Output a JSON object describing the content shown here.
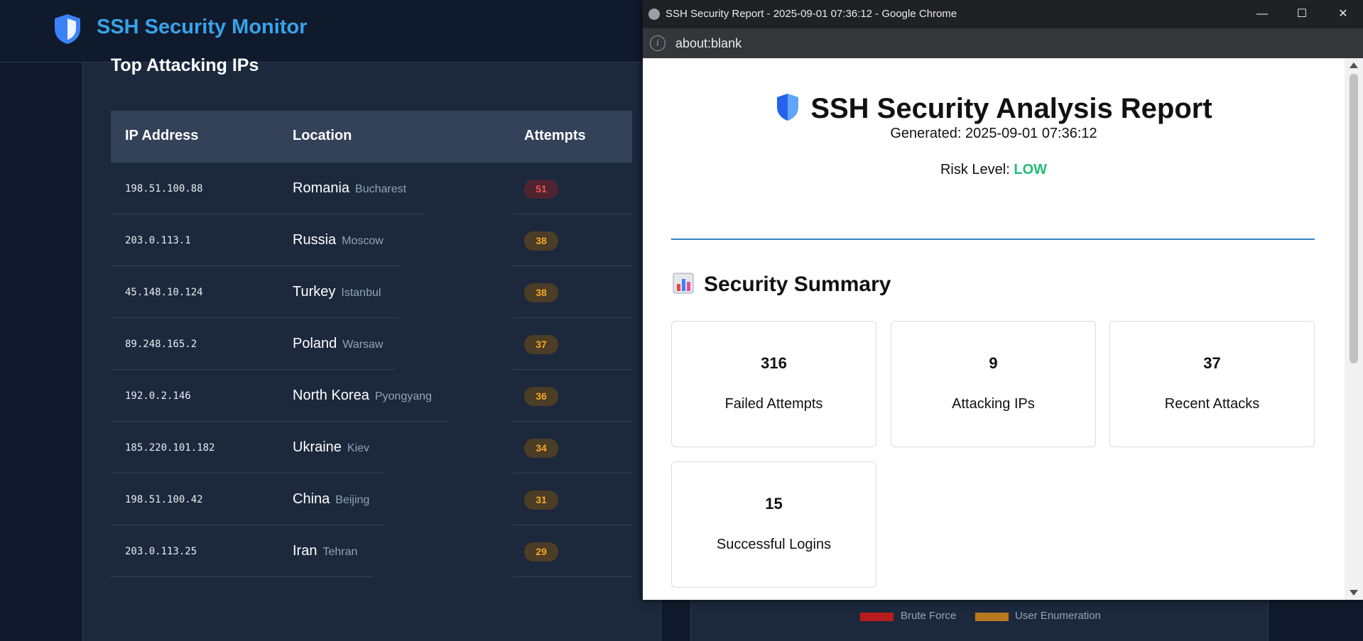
{
  "app": {
    "title": "SSH Security Monitor",
    "section_title": "Top Attacking IPs",
    "table": {
      "headers": [
        "IP Address",
        "Location",
        "Attempts"
      ],
      "rows": [
        {
          "ip": "198.51.100.88",
          "country": "Romania",
          "city": "Bucharest",
          "attempts": "51",
          "severity": "red"
        },
        {
          "ip": "203.0.113.1",
          "country": "Russia",
          "city": "Moscow",
          "attempts": "38",
          "severity": "orange"
        },
        {
          "ip": "45.148.10.124",
          "country": "Turkey",
          "city": "Istanbul",
          "attempts": "38",
          "severity": "orange"
        },
        {
          "ip": "89.248.165.2",
          "country": "Poland",
          "city": "Warsaw",
          "attempts": "37",
          "severity": "orange"
        },
        {
          "ip": "192.0.2.146",
          "country": "North Korea",
          "city": "Pyongyang",
          "attempts": "36",
          "severity": "orange"
        },
        {
          "ip": "185.220.101.182",
          "country": "Ukraine",
          "city": "Kiev",
          "attempts": "34",
          "severity": "orange"
        },
        {
          "ip": "198.51.100.42",
          "country": "China",
          "city": "Beijing",
          "attempts": "31",
          "severity": "orange"
        },
        {
          "ip": "203.0.113.25",
          "country": "Iran",
          "city": "Tehran",
          "attempts": "29",
          "severity": "orange"
        }
      ]
    },
    "legend": [
      {
        "label": "Brute Force",
        "color": "#b91c1c"
      },
      {
        "label": "User Enumeration",
        "color": "#b7791f"
      }
    ]
  },
  "browser": {
    "window_title": "SSH Security Report - 2025-09-01 07:36:12 - Google Chrome",
    "url": "about:blank",
    "controls": {
      "minimize": "—",
      "maximize": "☐",
      "close": "✕"
    }
  },
  "report": {
    "title": "SSH Security Analysis Report",
    "generated_label": "Generated: 2025-09-01 07:36:12",
    "risk_label": "Risk Level: ",
    "risk_value": "LOW",
    "summary_title": "Security Summary",
    "cards": [
      {
        "value": "316",
        "label": "Failed Attempts"
      },
      {
        "value": "9",
        "label": "Attacking IPs"
      },
      {
        "value": "37",
        "label": "Recent Attacks"
      },
      {
        "value": "15",
        "label": "Successful Logins"
      }
    ]
  },
  "colors": {
    "accent": "#38a3e8",
    "risk_low": "#1fbf74",
    "badge_red": "#f05252",
    "badge_orange": "#f5a623"
  }
}
